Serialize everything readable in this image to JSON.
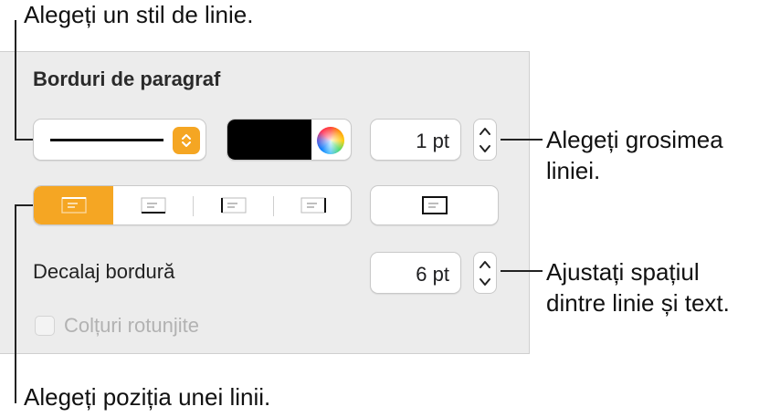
{
  "callouts": {
    "line_style": "Alegeți un stil de linie.",
    "thickness_line1": "Alegeți grosimea",
    "thickness_line2": "liniei.",
    "offset_line1": "Ajustați spațiul",
    "offset_line2": "dintre linie și text.",
    "position": "Alegeți poziția unei linii."
  },
  "panel": {
    "title": "Borduri de paragraf",
    "line_style": {
      "selected": "solid-line"
    },
    "color": {
      "swatch": "#000000"
    },
    "thickness": {
      "value": "1 pt"
    },
    "position_segments": [
      {
        "id": "top",
        "active": true
      },
      {
        "id": "bottom",
        "active": false
      },
      {
        "id": "left",
        "active": false
      },
      {
        "id": "right",
        "active": false
      }
    ],
    "border_box": {
      "id": "box"
    },
    "offset": {
      "label": "Decalaj bordură",
      "value": "6 pt"
    },
    "rounded_corners": {
      "label": "Colțuri rotunjite",
      "checked": false,
      "enabled": false
    }
  },
  "colors": {
    "accent": "#f5a623",
    "panel_bg": "#ececec"
  }
}
